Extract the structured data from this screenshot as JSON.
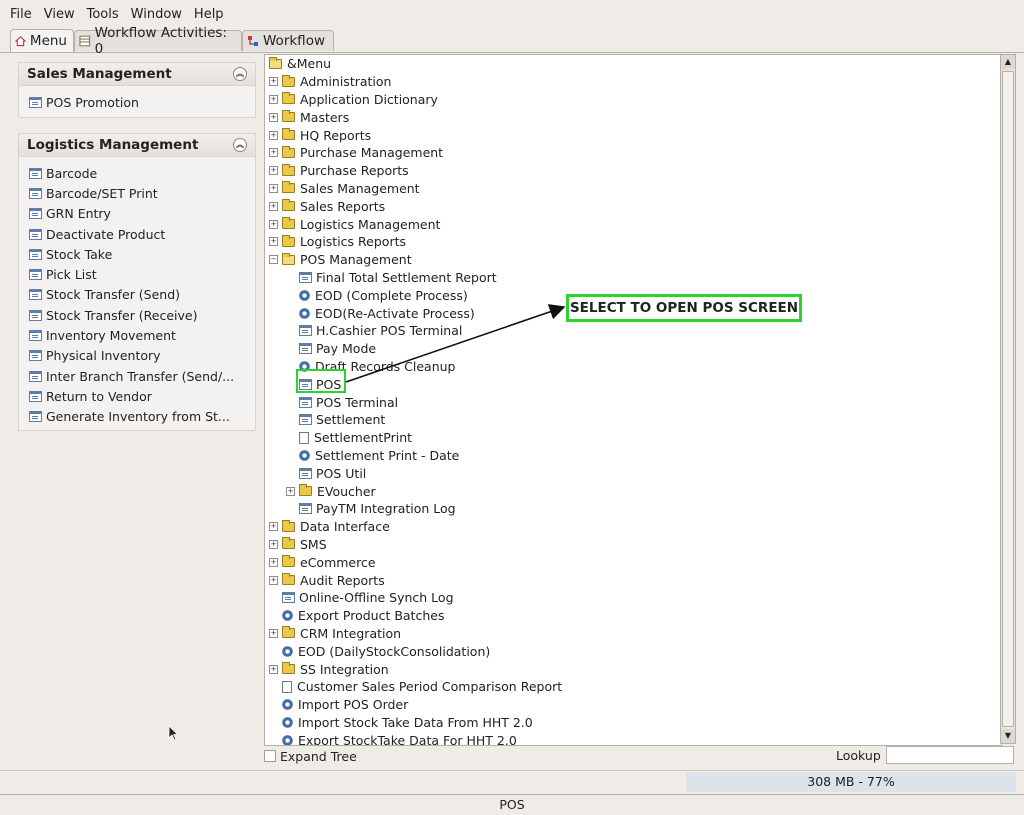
{
  "menubar": [
    "File",
    "View",
    "Tools",
    "Window",
    "Help"
  ],
  "tabs": [
    {
      "label": "Menu",
      "icon": "home-icon"
    },
    {
      "label": "Workflow Activities: 0",
      "icon": "table-icon"
    },
    {
      "label": "Workflow",
      "icon": "workflow-icon"
    }
  ],
  "sales_panel": {
    "title": "Sales Management",
    "items": [
      "POS Promotion"
    ]
  },
  "logistics_panel": {
    "title": "Logistics Management",
    "items": [
      "Barcode",
      "Barcode/SET Print",
      "GRN Entry",
      "Deactivate Product",
      "Stock Take",
      "Pick List",
      "Stock Transfer (Send)",
      "Stock Transfer (Receive)",
      "Inventory Movement",
      "Physical Inventory",
      "Inter Branch Transfer (Send/...",
      "Return to Vendor",
      "Generate Inventory from St..."
    ]
  },
  "tree": [
    {
      "label": "&Menu",
      "level": 0,
      "kind": "openfolder",
      "exp": ""
    },
    {
      "label": "Administration",
      "level": 0,
      "kind": "folder",
      "exp": "+"
    },
    {
      "label": "Application Dictionary",
      "level": 0,
      "kind": "folder",
      "exp": "+"
    },
    {
      "label": "Masters",
      "level": 0,
      "kind": "folder",
      "exp": "+"
    },
    {
      "label": "HQ Reports",
      "level": 0,
      "kind": "folder",
      "exp": "+"
    },
    {
      "label": "Purchase Management",
      "level": 0,
      "kind": "folder",
      "exp": "+"
    },
    {
      "label": "Purchase Reports",
      "level": 0,
      "kind": "folder",
      "exp": "+"
    },
    {
      "label": "Sales Management",
      "level": 0,
      "kind": "folder",
      "exp": "+"
    },
    {
      "label": "Sales Reports",
      "level": 0,
      "kind": "folder",
      "exp": "+"
    },
    {
      "label": "Logistics Management",
      "level": 0,
      "kind": "folder",
      "exp": "+"
    },
    {
      "label": "Logistics Reports",
      "level": 0,
      "kind": "folder",
      "exp": "+"
    },
    {
      "label": "POS Management",
      "level": 0,
      "kind": "openfolder",
      "exp": "-"
    },
    {
      "label": "Final Total Settlement Report",
      "level": 1,
      "kind": "window",
      "exp": ""
    },
    {
      "label": "EOD (Complete Process)",
      "level": 1,
      "kind": "process",
      "exp": ""
    },
    {
      "label": "EOD(Re-Activate Process)",
      "level": 1,
      "kind": "process",
      "exp": ""
    },
    {
      "label": "H.Cashier POS Terminal",
      "level": 1,
      "kind": "window",
      "exp": ""
    },
    {
      "label": "Pay Mode",
      "level": 1,
      "kind": "window",
      "exp": ""
    },
    {
      "label": "Draft Records Cleanup",
      "level": 1,
      "kind": "process",
      "exp": ""
    },
    {
      "label": "POS",
      "level": 1,
      "kind": "window",
      "exp": ""
    },
    {
      "label": "POS Terminal",
      "level": 1,
      "kind": "window",
      "exp": ""
    },
    {
      "label": "Settlement",
      "level": 1,
      "kind": "window",
      "exp": ""
    },
    {
      "label": "SettlementPrint",
      "level": 1,
      "kind": "report",
      "exp": ""
    },
    {
      "label": "Settlement Print - Date",
      "level": 1,
      "kind": "process",
      "exp": ""
    },
    {
      "label": "POS Util",
      "level": 1,
      "kind": "window",
      "exp": ""
    },
    {
      "label": "EVoucher",
      "level": 1,
      "kind": "folder",
      "exp": "+"
    },
    {
      "label": "PayTM Integration Log",
      "level": 1,
      "kind": "window",
      "exp": ""
    },
    {
      "label": "Data Interface",
      "level": 0,
      "kind": "folder",
      "exp": "+"
    },
    {
      "label": "SMS",
      "level": 0,
      "kind": "folder",
      "exp": "+"
    },
    {
      "label": "eCommerce",
      "level": 0,
      "kind": "folder",
      "exp": "+"
    },
    {
      "label": "Audit Reports",
      "level": 0,
      "kind": "folder",
      "exp": "+"
    },
    {
      "label": "Online-Offline Synch Log",
      "level": 0,
      "kind": "window",
      "exp": ""
    },
    {
      "label": "Export Product Batches",
      "level": 0,
      "kind": "process",
      "exp": ""
    },
    {
      "label": "CRM Integration",
      "level": 0,
      "kind": "folder",
      "exp": "+"
    },
    {
      "label": "EOD (DailyStockConsolidation)",
      "level": 0,
      "kind": "process",
      "exp": ""
    },
    {
      "label": "SS Integration",
      "level": 0,
      "kind": "folder",
      "exp": "+"
    },
    {
      "label": "Customer Sales Period Comparison Report",
      "level": 0,
      "kind": "report",
      "exp": ""
    },
    {
      "label": "Import POS Order",
      "level": 0,
      "kind": "process",
      "exp": ""
    },
    {
      "label": "Import Stock Take Data From HHT 2.0",
      "level": 0,
      "kind": "process",
      "exp": ""
    },
    {
      "label": "Export StockTake Data For HHT 2.0",
      "level": 0,
      "kind": "process",
      "exp": ""
    }
  ],
  "bottom": {
    "expand_tree": "Expand Tree",
    "lookup": "Lookup",
    "lookup_value": ""
  },
  "status": {
    "memory": "308 MB - 77%",
    "footer": "POS"
  },
  "annotation": {
    "callout": "SELECT TO OPEN POS SCREEN",
    "color": "#2ed42e"
  }
}
